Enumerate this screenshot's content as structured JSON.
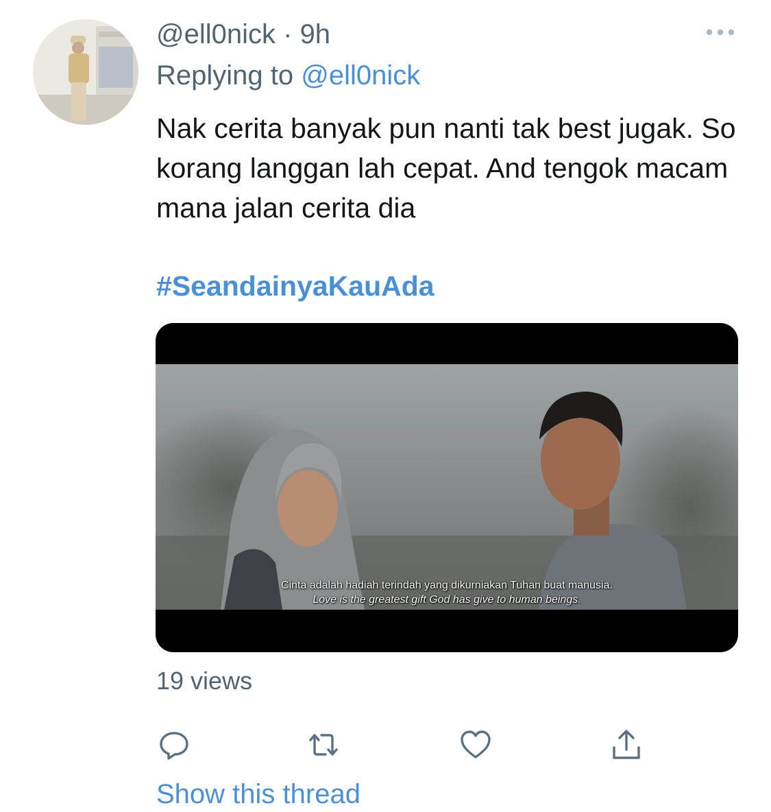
{
  "tweet": {
    "handle": "@ell0nick",
    "separator": " · ",
    "time": "9h",
    "replying_prefix": "Replying to ",
    "replying_handle": "@ell0nick",
    "text": "Nak cerita banyak pun nanti tak best jugak. So korang langgan lah cepat. And tengok macam mana jalan cerita dia",
    "hashtag": "#SeandainyaKauAda",
    "media": {
      "subtitle_ms": "Cinta adalah hadiah terindah yang dikurniakan Tuhan buat manusia.",
      "subtitle_en": "Love is the greatest gift God has give to human beings."
    },
    "views": "19 views",
    "show_thread": "Show this thread"
  },
  "icons": {
    "more": "more-horizontal-icon",
    "reply": "reply-icon",
    "retweet": "retweet-icon",
    "like": "like-icon",
    "share": "share-icon"
  },
  "colors": {
    "link": "#4a90d6",
    "secondary_text": "#536471",
    "primary_text": "#14171a",
    "icon": "#5b7083"
  }
}
